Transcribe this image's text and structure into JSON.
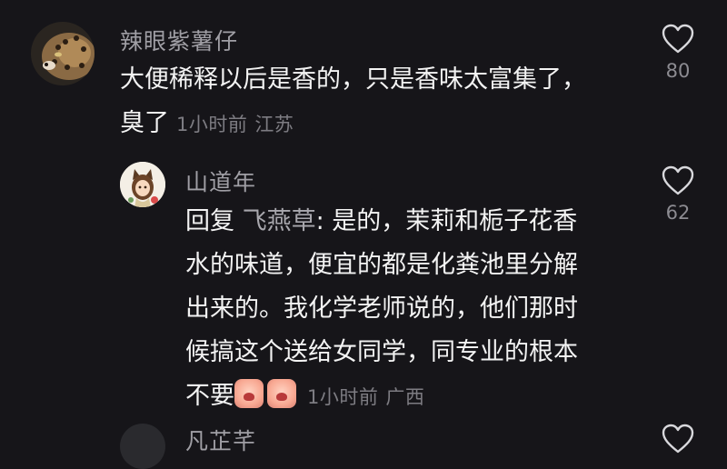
{
  "comments": [
    {
      "username": "辣眼紫薯仔",
      "text_line1": "大便稀释以后是香的，只是香味太富集了，",
      "text_line2": "臭了",
      "time": "1小时前",
      "location": "江苏",
      "likes": "80",
      "avatar_icon": "leopard-avatar"
    },
    {
      "username": "山道年",
      "reply_prefix": "回复",
      "reply_target": "飞燕草",
      "text_first": ": 是的，茉莉和栀子花香",
      "text_line2": "水的味道，便宜的都是化粪池里分解",
      "text_line3": "出来的。我化学老师说的，他们那时",
      "text_line4": "候搞这个送给女同学，同专业的根本",
      "text_line5": "不要",
      "emojis": [
        "crying-face-emoji",
        "crying-face-emoji"
      ],
      "time": "1小时前",
      "location": "广西",
      "likes": "62",
      "avatar_icon": "anime-girl-avatar"
    },
    {
      "username": "凡芷芊",
      "avatar_icon": "user-avatar"
    }
  ],
  "colors": {
    "background": "#161519",
    "username": "#a09fa5",
    "text": "#f3f3f3",
    "meta": "#7d7c82"
  }
}
